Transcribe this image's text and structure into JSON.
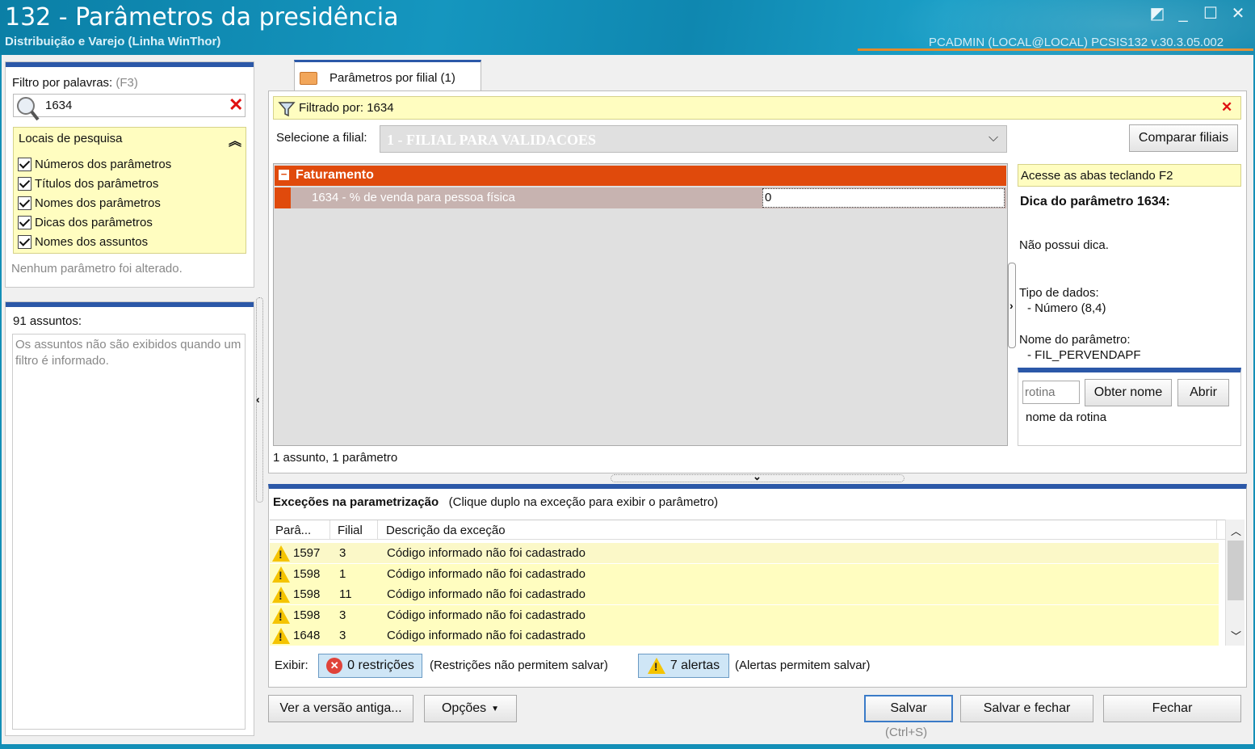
{
  "window": {
    "title": "132 - Parâmetros da presidência",
    "subtitle": "Distribuição e Varejo (Linha WinThor)",
    "user_info": "PCADMIN (LOCAL@LOCAL)  PCSIS132  v.30.3.05.002"
  },
  "sidebar": {
    "filter_label": "Filtro por palavras:",
    "filter_shortcut": "(F3)",
    "filter_value": "1634",
    "search_locations_label": "Locais de pesquisa",
    "checkboxes": [
      {
        "label": "Números dos parâmetros"
      },
      {
        "label": "Títulos dos parâmetros"
      },
      {
        "label": "Nomes dos parâmetros"
      },
      {
        "label": "Dicas dos parâmetros"
      },
      {
        "label": "Nomes dos assuntos"
      }
    ],
    "status": "Nenhum parâmetro foi alterado.",
    "subjects_count": "91 assuntos:",
    "subjects_note": "Os assuntos não são exibidos quando um filtro é informado."
  },
  "main": {
    "tab_label": "Parâmetros por filial  (1)",
    "filter_bar": "Filtrado por: 1634",
    "branch_label": "Selecione a filial:",
    "branch_value": "1 - FILIAL PARA VALIDACOES",
    "compare_button": "Comparar filiais",
    "group_title": "Faturamento",
    "param_label": "1634 - % de venda para pessoa física",
    "param_value": "0",
    "summary": "1 assunto, 1 parâmetro"
  },
  "hint": {
    "tab_hint": "Acesse as abas teclando F2",
    "title": "Dica do parâmetro 1634:",
    "text": "Não possui dica.",
    "data_type_label": "Tipo de dados:",
    "data_type_value": "- Número (8,4)",
    "name_label": "Nome do parâmetro:",
    "name_value": "- FIL_PERVENDAPF",
    "routine_placeholder": "rotina",
    "get_name_button": "Obter nome",
    "open_button": "Abrir",
    "routine_name_label": "nome da rotina"
  },
  "exceptions": {
    "title": "Exceções na parametrização",
    "subtitle": "(Clique duplo na exceção para exibir o parâmetro)",
    "columns": [
      "Parâ...",
      "Filial",
      "Descrição da exceção"
    ],
    "rows": [
      {
        "param": "1597",
        "branch": "3",
        "desc": "Código informado não foi cadastrado"
      },
      {
        "param": "1598",
        "branch": "1",
        "desc": "Código informado não foi cadastrado"
      },
      {
        "param": "1598",
        "branch": "11",
        "desc": "Código informado não foi cadastrado"
      },
      {
        "param": "1598",
        "branch": "3",
        "desc": "Código informado não foi cadastrado"
      },
      {
        "param": "1648",
        "branch": "3",
        "desc": "Código informado não foi cadastrado"
      }
    ],
    "show_label": "Exibir:",
    "restrictions_button": "0 restrições",
    "restrictions_note": "(Restrições não permitem salvar)",
    "alerts_button": "7 alertas",
    "alerts_note": "(Alertas permitem salvar)"
  },
  "footer": {
    "old_version_button": "Ver a versão antiga...",
    "options_button": "Opções",
    "save_button": "Salvar",
    "save_shortcut": "(Ctrl+S)",
    "save_close_button": "Salvar e fechar",
    "close_button": "Fechar"
  }
}
